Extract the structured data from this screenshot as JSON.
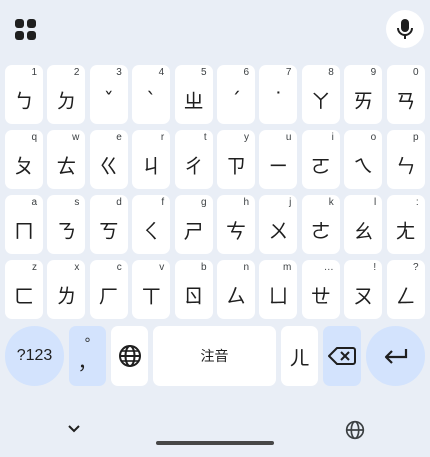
{
  "topbar": {
    "apps_icon": "apps-grid-icon",
    "mic_icon": "mic-icon"
  },
  "rows": [
    [
      {
        "hint": "1",
        "main": "ㄅ"
      },
      {
        "hint": "2",
        "main": "ㄉ"
      },
      {
        "hint": "3",
        "main": "ˇ"
      },
      {
        "hint": "4",
        "main": "ˋ"
      },
      {
        "hint": "5",
        "main": "ㄓ"
      },
      {
        "hint": "6",
        "main": "ˊ"
      },
      {
        "hint": "7",
        "main": "˙"
      },
      {
        "hint": "8",
        "main": "ㄚ"
      },
      {
        "hint": "9",
        "main": "ㄞ"
      },
      {
        "hint": "0",
        "main": "ㄢ"
      }
    ],
    [
      {
        "hint": "q",
        "main": "ㄆ"
      },
      {
        "hint": "w",
        "main": "ㄊ"
      },
      {
        "hint": "e",
        "main": "ㄍ"
      },
      {
        "hint": "r",
        "main": "ㄐ"
      },
      {
        "hint": "t",
        "main": "ㄔ"
      },
      {
        "hint": "y",
        "main": "ㄗ"
      },
      {
        "hint": "u",
        "main": "ㄧ"
      },
      {
        "hint": "i",
        "main": "ㄛ"
      },
      {
        "hint": "o",
        "main": "ㄟ"
      },
      {
        "hint": "p",
        "main": "ㄣ"
      }
    ],
    [
      {
        "hint": "a",
        "main": "ㄇ"
      },
      {
        "hint": "s",
        "main": "ㄋ"
      },
      {
        "hint": "d",
        "main": "ㄎ"
      },
      {
        "hint": "f",
        "main": "ㄑ"
      },
      {
        "hint": "g",
        "main": "ㄕ"
      },
      {
        "hint": "h",
        "main": "ㄘ"
      },
      {
        "hint": "j",
        "main": "ㄨ"
      },
      {
        "hint": "k",
        "main": "ㄜ"
      },
      {
        "hint": "l",
        "main": "ㄠ"
      },
      {
        "hint": ":",
        "main": "ㄤ"
      }
    ],
    [
      {
        "hint": "z",
        "main": "ㄈ"
      },
      {
        "hint": "x",
        "main": "ㄌ"
      },
      {
        "hint": "c",
        "main": "ㄏ"
      },
      {
        "hint": "v",
        "main": "ㄒ"
      },
      {
        "hint": "b",
        "main": "ㄖ"
      },
      {
        "hint": "n",
        "main": "ㄙ"
      },
      {
        "hint": "m",
        "main": "ㄩ"
      },
      {
        "hint": "…",
        "main": "ㄝ"
      },
      {
        "hint": "!",
        "main": "ㄡ"
      },
      {
        "hint": "?",
        "main": "ㄥ"
      }
    ]
  ],
  "bottom_row": {
    "symbols_label": "?123",
    "punct_top": "°",
    "punct_main": "，",
    "globe_icon": "globe-icon",
    "space_label": "注音",
    "er_label": "ㄦ",
    "backspace_icon": "backspace-icon",
    "enter_icon": "enter-icon"
  },
  "nav": {
    "chevron_icon": "chevron-down-icon",
    "globe_icon": "globe-icon"
  },
  "colors": {
    "background": "#e9eef6",
    "key": "#ffffff",
    "special_key": "#d3e3fd",
    "text": "#1f1f1f"
  }
}
